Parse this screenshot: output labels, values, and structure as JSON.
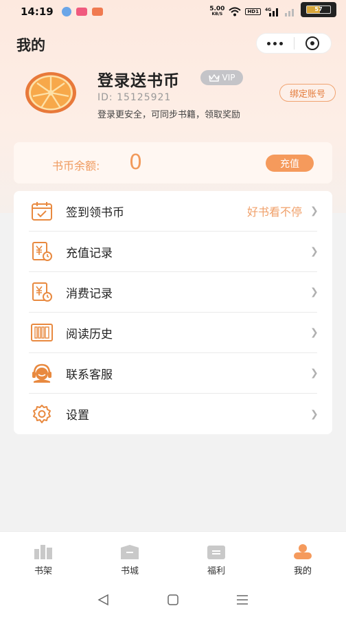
{
  "status_bar": {
    "time": "14:19",
    "net_speed_value": "5.00",
    "net_speed_unit": "KB/S",
    "hd_label": "HD1",
    "signal_label": "4G",
    "battery_level": "57",
    "battery_fraction": 0.57
  },
  "header": {
    "title": "我的"
  },
  "user": {
    "name": "登录送书币",
    "vip_label": "VIP",
    "id_text": "ID: 15125921",
    "tip": "登录更安全，可同步书籍，领取奖励",
    "bind_button": "绑定账号"
  },
  "coins": {
    "label": "书币余额:",
    "value": "0",
    "recharge_button": "充值"
  },
  "menu": [
    {
      "label": "签到领书币",
      "extra": "好书看不停",
      "icon": "calendar-check-icon"
    },
    {
      "label": "充值记录",
      "extra": "",
      "icon": "yen-receipt-icon"
    },
    {
      "label": "消费记录",
      "extra": "",
      "icon": "yen-receipt-icon"
    },
    {
      "label": "阅读历史",
      "extra": "",
      "icon": "history-books-icon"
    },
    {
      "label": "联系客服",
      "extra": "",
      "icon": "headset-icon"
    },
    {
      "label": "设置",
      "extra": "",
      "icon": "gear-icon"
    }
  ],
  "tabbar": [
    {
      "label": "书架",
      "icon": "bookshelf-icon",
      "active": false
    },
    {
      "label": "书城",
      "icon": "bookstore-icon",
      "active": false
    },
    {
      "label": "福利",
      "icon": "gift-icon",
      "active": false
    },
    {
      "label": "我的",
      "icon": "user-icon",
      "active": true
    }
  ],
  "colors": {
    "accent": "#f59a5c",
    "header_bg": "#fde9df",
    "icon_inactive": "#c9c9c9"
  }
}
